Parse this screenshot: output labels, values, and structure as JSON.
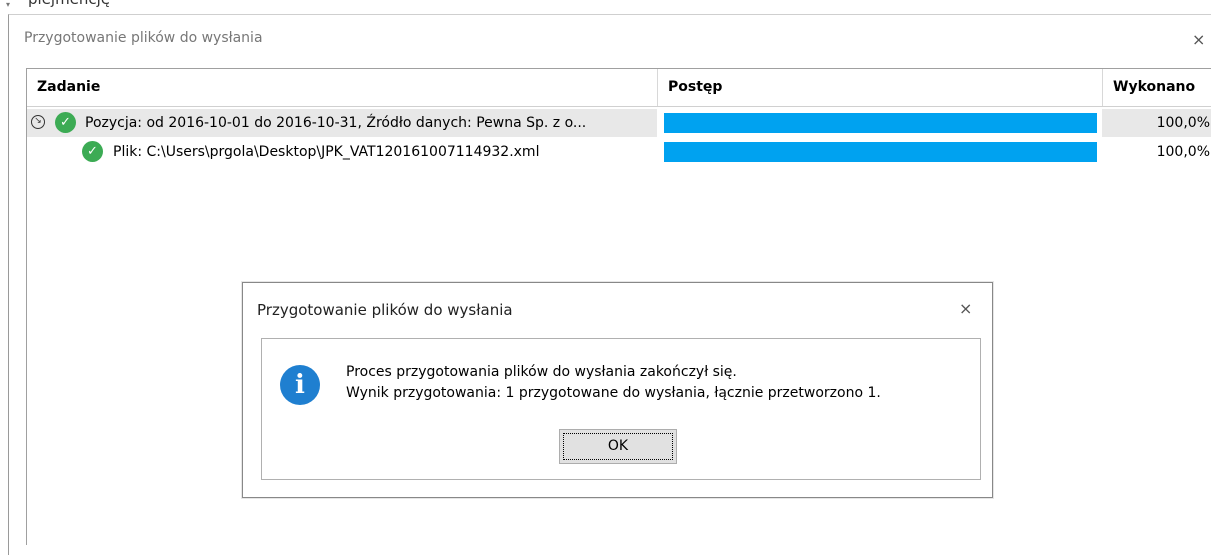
{
  "top_fragment": {
    "text": "plejmencję"
  },
  "window": {
    "title": "Przygotowanie plików do wysłania",
    "close_glyph": "×"
  },
  "grid": {
    "columns": [
      "Zadanie",
      "Postęp",
      "Wykonano"
    ],
    "rows": [
      {
        "task": "Pozycja: od 2016-10-01 do 2016-10-31, Źródło danych: Pewna Sp. z o...",
        "progress": 1.0,
        "done": "100,0%",
        "expander_glyph": "↘",
        "check_glyph": "✓"
      },
      {
        "task": "Plik: C:\\Users\\prgola\\Desktop\\JPK_VAT120161007114932.xml",
        "progress": 1.0,
        "done": "100,0%",
        "check_glyph": "✓"
      }
    ]
  },
  "dialog": {
    "title": "Przygotowanie plików do wysłania",
    "close_glyph": "×",
    "icon": "info-icon",
    "icon_glyph": "i",
    "message_line1": "Proces przygotowania plików do wysłania zakończył się.",
    "message_line2": "Wynik przygotowania: 1 przygotowane do wysłania, łącznie przetworzono 1.",
    "ok_label": "OK"
  },
  "colors": {
    "progress_fill": "#00a2f0",
    "check_green": "#3cab54",
    "info_blue": "#1f7fd0",
    "selected_row": "#e8e8e8"
  }
}
